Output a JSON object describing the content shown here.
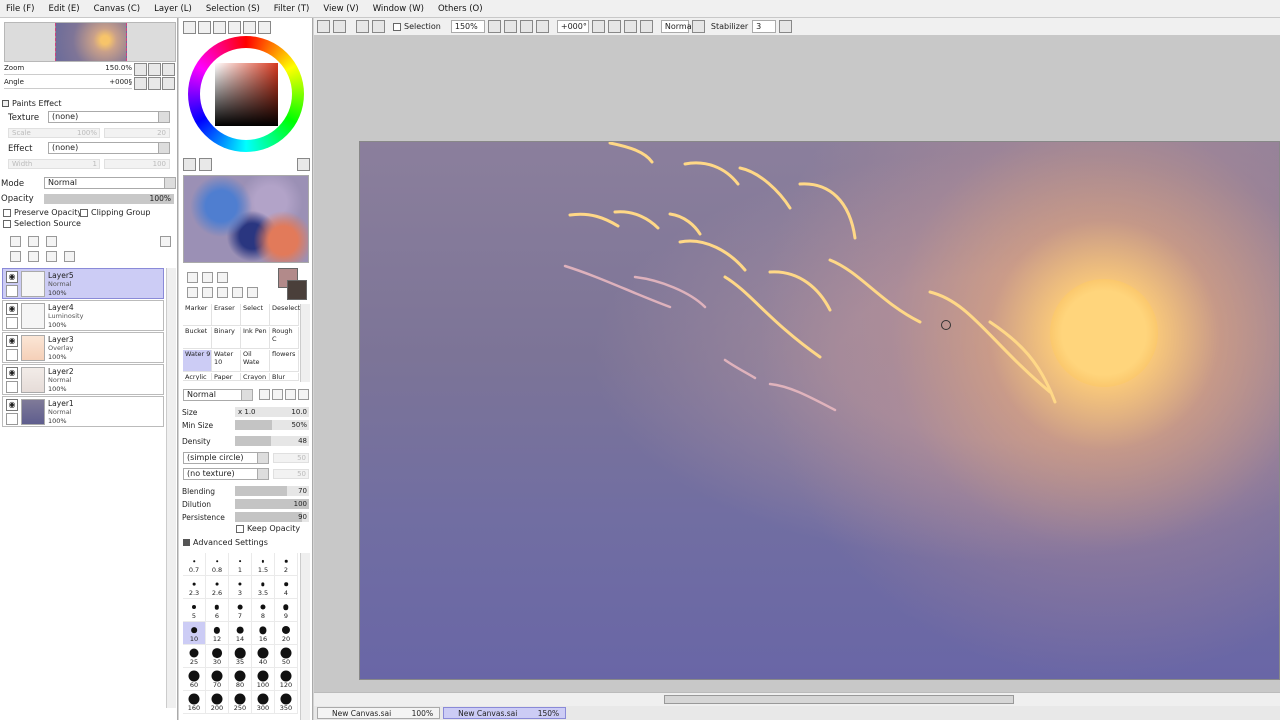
{
  "menu": [
    "File (F)",
    "Edit (E)",
    "Canvas (C)",
    "Layer (L)",
    "Selection (S)",
    "Filter (T)",
    "View (V)",
    "Window (W)",
    "Others (O)"
  ],
  "navigator": {
    "zoom_label": "Zoom",
    "zoom_value": "150.0%",
    "angle_label": "Angle",
    "angle_value": "+000§"
  },
  "paints_effect": {
    "title": "Paints Effect",
    "texture_label": "Texture",
    "texture_value": "(none)",
    "texture_scale_label": "Scale",
    "texture_scale_value": "100%",
    "texture_strength_value": "20",
    "effect_label": "Effect",
    "effect_value": "(none)",
    "effect_width_label": "Width",
    "effect_width_value": "1",
    "effect_strength_value": "100"
  },
  "layer_props": {
    "mode_label": "Mode",
    "mode_value": "Normal",
    "opacity_label": "Opacity",
    "opacity_value": "100%",
    "preserve_opacity": "Preserve Opacity",
    "clipping_group": "Clipping Group",
    "selection_source": "Selection Source"
  },
  "layers": [
    {
      "name": "Layer5",
      "mode": "Normal",
      "opacity": "100%",
      "selected": true
    },
    {
      "name": "Layer4",
      "mode": "Luminosity",
      "opacity": "100%",
      "selected": false
    },
    {
      "name": "Layer3",
      "mode": "Overlay",
      "opacity": "100%",
      "selected": false
    },
    {
      "name": "Layer2",
      "mode": "Normal",
      "opacity": "100%",
      "selected": false
    },
    {
      "name": "Layer1",
      "mode": "Normal",
      "opacity": "100%",
      "selected": false
    }
  ],
  "brush_tools": [
    [
      "Marker",
      "Eraser",
      "Select",
      "Deselect"
    ],
    [
      "Bucket",
      "Binary",
      "Ink Pen",
      "Rough C"
    ],
    [
      "Water 9",
      "Water 10",
      "Oil Wate",
      "flowers"
    ],
    [
      "Acrylic",
      "Paper",
      "Crayon",
      "Blur"
    ]
  ],
  "brush_props": {
    "blend_mode": "Normal",
    "size_label": "Size",
    "size_mult": "x 1.0",
    "size_value": "10.0",
    "min_size_label": "Min Size",
    "min_size_value": "50%",
    "density_label": "Density",
    "density_value": "48",
    "shape": "(simple circle)",
    "shape_value": "50",
    "texture": "(no texture)",
    "texture_value": "50",
    "blending_label": "Blending",
    "blending_value": "70",
    "dilution_label": "Dilution",
    "dilution_value": "100",
    "persistence_label": "Persistence",
    "persistence_value": "90",
    "keep_opacity": "Keep Opacity",
    "advanced": "Advanced Settings"
  },
  "brush_sizes": [
    "0.7",
    "0.8",
    "1",
    "1.5",
    "2",
    "2.3",
    "2.6",
    "3",
    "3.5",
    "4",
    "5",
    "6",
    "7",
    "8",
    "9",
    "10",
    "12",
    "14",
    "16",
    "20",
    "25",
    "30",
    "35",
    "40",
    "50",
    "60",
    "70",
    "80",
    "100",
    "120",
    "160",
    "200",
    "250",
    "300",
    "350"
  ],
  "canvas_toolbar": {
    "selection": "Selection",
    "zoom": "150%",
    "angle": "+000°",
    "blend": "Normal",
    "stabilizer_label": "Stabilizer",
    "stabilizer_value": "3"
  },
  "tabs": [
    {
      "name": "New Canvas.sai",
      "zoom": "100%",
      "active": false
    },
    {
      "name": "New Canvas.sai",
      "zoom": "150%",
      "active": true
    }
  ],
  "colors": {
    "selected_layer": "#ccccf5",
    "sun": "#ffd57c",
    "sky_bottom": "#6966a6",
    "primary": "#b28a8a",
    "secondary": "#4a3f3a"
  },
  "progress": {
    "min_size": 0.5,
    "density": 0.48,
    "blending": 0.7,
    "dilution": 1.0,
    "persistence": 0.9
  }
}
